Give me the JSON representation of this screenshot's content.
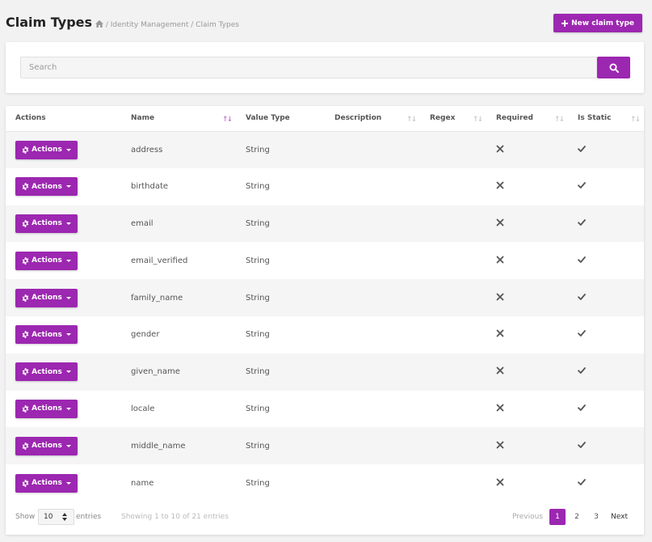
{
  "header": {
    "title": "Claim Types",
    "breadcrumb": "/ Identity Management / Claim Types",
    "new_button": "New claim type"
  },
  "search": {
    "placeholder": "Search"
  },
  "table": {
    "columns": [
      "Actions",
      "Name",
      "Value Type",
      "Description",
      "Regex",
      "Required",
      "Is Static"
    ],
    "action_label": "Actions",
    "rows": [
      {
        "name": "address",
        "value_type": "String",
        "required": false,
        "is_static": true
      },
      {
        "name": "birthdate",
        "value_type": "String",
        "required": false,
        "is_static": true
      },
      {
        "name": "email",
        "value_type": "String",
        "required": false,
        "is_static": true
      },
      {
        "name": "email_verified",
        "value_type": "String",
        "required": false,
        "is_static": true
      },
      {
        "name": "family_name",
        "value_type": "String",
        "required": false,
        "is_static": true
      },
      {
        "name": "gender",
        "value_type": "String",
        "required": false,
        "is_static": true
      },
      {
        "name": "given_name",
        "value_type": "String",
        "required": false,
        "is_static": true
      },
      {
        "name": "locale",
        "value_type": "String",
        "required": false,
        "is_static": true
      },
      {
        "name": "middle_name",
        "value_type": "String",
        "required": false,
        "is_static": true
      },
      {
        "name": "name",
        "value_type": "String",
        "required": false,
        "is_static": true
      }
    ]
  },
  "footer": {
    "show_label": "Show",
    "page_length": "10",
    "entries_label": "entries",
    "info": "Showing 1 to 10 of 21 entries",
    "previous": "Previous",
    "pages": [
      "1",
      "2",
      "3"
    ],
    "current_page": "1",
    "next": "Next"
  },
  "colors": {
    "accent": "#9c27b0",
    "background": "#f2f2f3"
  }
}
